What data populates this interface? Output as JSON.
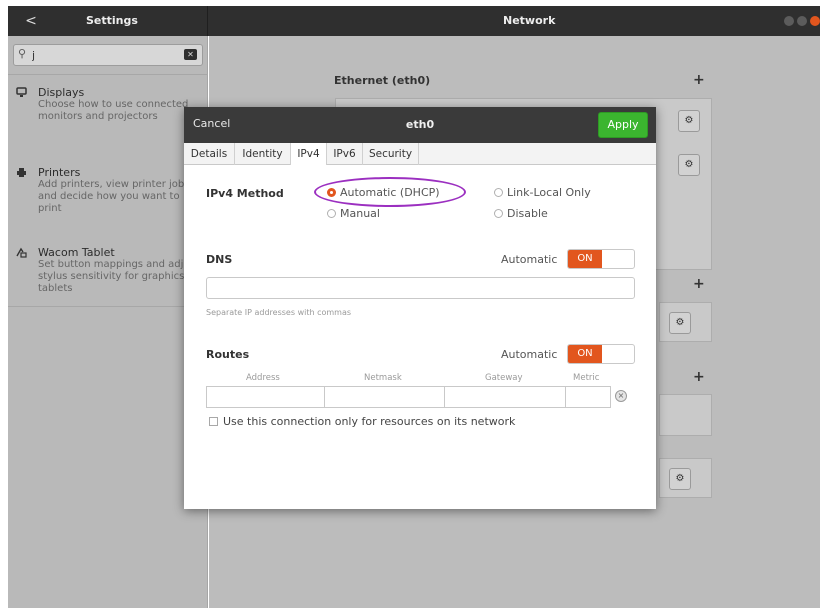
{
  "header": {
    "back_symbol": "<",
    "left_title": "Settings",
    "main_title": "Network"
  },
  "sidebar": {
    "search": {
      "value": "j",
      "placeholder": ""
    },
    "items": [
      {
        "icon": "display-icon",
        "title": "Displays",
        "description": "Choose how to use connected monitors and projectors"
      },
      {
        "icon": "printer-icon",
        "title": "Printers",
        "description": "Add printers, view printer jobs and decide how you want to print"
      },
      {
        "icon": "wacom-tablet-icon",
        "title": "Wacom Tablet",
        "description": "Set button mappings and adjust stylus sensitivity for graphics tablets"
      }
    ]
  },
  "main": {
    "section_title": "Ethernet (eth0)"
  },
  "dialog": {
    "cancel_label": "Cancel",
    "title": "eth0",
    "apply_label": "Apply",
    "tabs": [
      "Details",
      "Identity",
      "IPv4",
      "IPv6",
      "Security"
    ],
    "active_tab": "IPv4",
    "ipv4_method_label": "IPv4 Method",
    "methods": {
      "automatic": "Automatic (DHCP)",
      "manual": "Manual",
      "link_local": "Link-Local Only",
      "disable": "Disable"
    },
    "selected_method": "Automatic (DHCP)",
    "dns": {
      "label": "DNS",
      "automatic_label": "Automatic",
      "toggle_label": "ON",
      "value": "",
      "hint": "Separate IP addresses with commas"
    },
    "routes": {
      "label": "Routes",
      "automatic_label": "Automatic",
      "toggle_label": "ON",
      "columns": [
        "Address",
        "Netmask",
        "Gateway",
        "Metric"
      ]
    },
    "only_resources_label": "Use this connection only for resources on its network"
  },
  "colors": {
    "accent": "#e2561e",
    "apply_green": "#3bb52f",
    "highlight_purple": "#9b2fc0"
  }
}
